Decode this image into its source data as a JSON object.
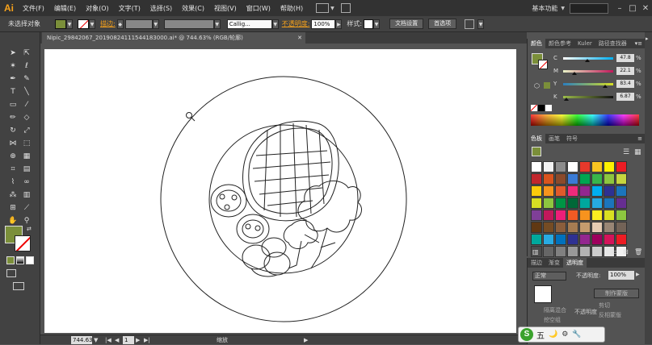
{
  "app": {
    "logo": "Ai",
    "workspace": "基本功能"
  },
  "menu": [
    "文件(F)",
    "编辑(E)",
    "对象(O)",
    "文字(T)",
    "选择(S)",
    "效果(C)",
    "视图(V)",
    "窗口(W)",
    "帮助(H)"
  ],
  "window_buttons": [
    "–",
    "□",
    "✕"
  ],
  "control": {
    "selection_status": "未选择对象",
    "fill_color": "#7b8f3a",
    "stroke_label": "描边:",
    "brush_value": "Callig...",
    "opacity_label": "不透明度:",
    "opacity_value": "100%",
    "style_label": "样式:",
    "doc_setup": "文档设置",
    "preferences": "首选项"
  },
  "document": {
    "tab_title": "Nipic_29842067_20190824111544183000.ai* @ 744.63% (RGB/轮廓)",
    "close": "✕"
  },
  "status": {
    "zoom": "744.63",
    "page": "1",
    "info": "缩放"
  },
  "color_panel": {
    "tabs": [
      "颜色",
      "颜色参考",
      "Kuler",
      "路径查找器"
    ],
    "menu": "▾≡",
    "channels": [
      {
        "label": "C",
        "value": "47.8",
        "unit": "%",
        "level": 0.478,
        "from": "#ffffff",
        "to": "#00aeef"
      },
      {
        "label": "M",
        "value": "22.1",
        "unit": "%",
        "level": 0.221,
        "from": "#ffffff",
        "to": "#ec008c"
      },
      {
        "label": "Y",
        "value": "83.4",
        "unit": "%",
        "level": 0.834,
        "from": "#ffffff",
        "to": "#fff200"
      },
      {
        "label": "K",
        "value": "6.87",
        "unit": "%",
        "level": 0.0687,
        "from": "#ffffff",
        "to": "#000000"
      }
    ]
  },
  "swatches_panel": {
    "tabs": [
      "色板",
      "画笔",
      "符号"
    ],
    "menu": "≡",
    "colors": [
      "#ffffff",
      "#f2f2f2",
      "#8c8c8c",
      "#ffffff",
      "#e6392b",
      "#f7c521",
      "#fef200",
      "#ed1c24",
      "#c1272d",
      "#d9541e",
      "#8b4a2b",
      "#3a7bd5",
      "#00a651",
      "#39b54a",
      "#8dc63f",
      "#c6d63f",
      "#fbcb0b",
      "#f7941d",
      "#e05a2b",
      "#ee2a7b",
      "#92278f",
      "#00aeef",
      "#2e3192",
      "#1b75bb",
      "#d7df23",
      "#8dc63f",
      "#009444",
      "#006838",
      "#00a79d",
      "#27aae1",
      "#1c75bc",
      "#662d91",
      "#7f3f98",
      "#c2185b",
      "#ed1e79",
      "#f15a24",
      "#f7931e",
      "#fcee21",
      "#d9e021",
      "#8cc63f",
      "#603813",
      "#754c24",
      "#8b5e3c",
      "#a67c52",
      "#c69c6d",
      "#e6ccb3",
      "#998675",
      "#736357",
      "#00a99d",
      "#29abe2",
      "#0071bc",
      "#2e3192",
      "#93278f",
      "#9e005d",
      "#d4145a",
      "#ed1c24",
      "#4d4d4d",
      "#666666",
      "#808080",
      "#999999",
      "#b3b3b3",
      "#cccccc",
      "#e6e6e6",
      "#f2f2f2"
    ]
  },
  "transparency_panel": {
    "tabs": [
      "描边",
      "渐变",
      "透明度"
    ],
    "mode": "正常",
    "opacity_label": "不透明度:",
    "opacity_value": "100%",
    "make_mask": "制作蒙版",
    "clip": "剪切",
    "invert_mask": "反相蒙版",
    "faint_1": "隔离混合",
    "faint_2": "挖空组",
    "faint_3": "不透明度"
  },
  "ime": {
    "logo": "S",
    "label": "五",
    "icons": [
      "🌙",
      "⚙",
      "🔧"
    ]
  }
}
